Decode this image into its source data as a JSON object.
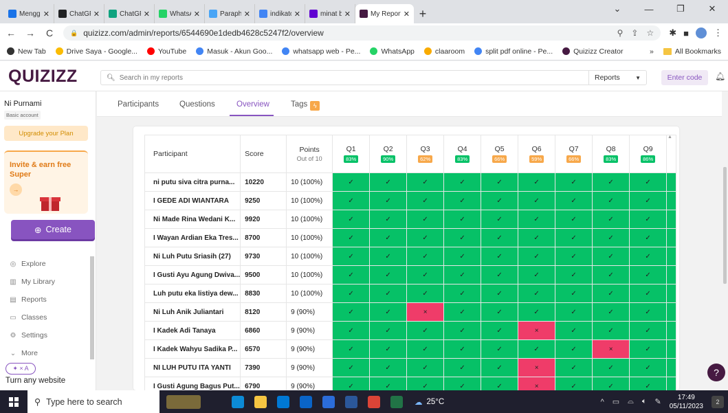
{
  "browser": {
    "tabs": [
      {
        "label": "Mengguna",
        "color": "#1a73e8"
      },
      {
        "label": "ChatGPT",
        "color": "#202123"
      },
      {
        "label": "ChatGPT",
        "color": "#10a37f"
      },
      {
        "label": "WhatsApp",
        "color": "#25d366"
      },
      {
        "label": "Paraphras",
        "color": "#49a5f6"
      },
      {
        "label": "indikator t",
        "color": "#4285f4"
      },
      {
        "label": "minat berp",
        "color": "#6001d2"
      },
      {
        "label": "My Report",
        "color": "#461a42"
      }
    ],
    "new_tab": "+",
    "url": "quizizz.com/admin/reports/6544690e1dedb4628c5247f2/overview",
    "bookmarks": [
      {
        "label": "New Tab",
        "color": "#333333"
      },
      {
        "label": "Drive Saya - Google...",
        "color": "#fbbc04"
      },
      {
        "label": "YouTube",
        "color": "#ff0000"
      },
      {
        "label": "Masuk - Akun Goo...",
        "color": "#4285f4"
      },
      {
        "label": "whatsapp web - Pe...",
        "color": "#4285f4"
      },
      {
        "label": "WhatsApp",
        "color": "#25d366"
      },
      {
        "label": "claaroom",
        "color": "#f9ab00"
      },
      {
        "label": "split pdf online - Pe...",
        "color": "#4285f4"
      },
      {
        "label": "Quizizz Creator",
        "color": "#461a42"
      }
    ],
    "more_bookmarks": "»",
    "all_bookmarks": "All Bookmarks"
  },
  "header": {
    "logo": "QUIZIZZ",
    "search_placeholder": "Search in my reports",
    "reports_select": "Reports",
    "enter_code": "Enter code"
  },
  "sidebar": {
    "user_name": "Ni Purnami",
    "account_type": "Basic account",
    "upgrade": "Upgrade your Plan",
    "invite": "Invite & earn free Super",
    "create": "Create",
    "nav": [
      "Explore",
      "My Library",
      "Reports",
      "Classes",
      "Settings",
      "More"
    ],
    "promo_pill": "✦ × A",
    "promo_text": "Turn any website"
  },
  "report_tabs": {
    "participants": "Participants",
    "questions": "Questions",
    "overview": "Overview",
    "tags": "Tags"
  },
  "table": {
    "headers": {
      "participant": "Participant",
      "score": "Score",
      "points": "Points",
      "points_sub": "Out of 10"
    },
    "questions": [
      {
        "label": "Q1",
        "pct": "83%",
        "color": "#06c167"
      },
      {
        "label": "Q2",
        "pct": "90%",
        "color": "#06c167"
      },
      {
        "label": "Q3",
        "pct": "62%",
        "color": "#f7a84a"
      },
      {
        "label": "Q4",
        "pct": "83%",
        "color": "#06c167"
      },
      {
        "label": "Q5",
        "pct": "66%",
        "color": "#f7a84a"
      },
      {
        "label": "Q6",
        "pct": "59%",
        "color": "#f7a84a"
      },
      {
        "label": "Q7",
        "pct": "66%",
        "color": "#f7a84a"
      },
      {
        "label": "Q8",
        "pct": "83%",
        "color": "#06c167"
      },
      {
        "label": "Q9",
        "pct": "86%",
        "color": "#06c167"
      }
    ],
    "rows": [
      {
        "name": "ni putu siva citra purna...",
        "score": "10220",
        "points": "10 (100%)",
        "answers": [
          1,
          1,
          1,
          1,
          1,
          1,
          1,
          1,
          1
        ]
      },
      {
        "name": "I GEDE ADI WIANTARA",
        "score": "9250",
        "points": "10 (100%)",
        "answers": [
          1,
          1,
          1,
          1,
          1,
          1,
          1,
          1,
          1
        ]
      },
      {
        "name": "Ni Made Rina Wedani K...",
        "score": "9920",
        "points": "10 (100%)",
        "answers": [
          1,
          1,
          1,
          1,
          1,
          1,
          1,
          1,
          1
        ]
      },
      {
        "name": "I Wayan Ardian Eka Tres...",
        "score": "8700",
        "points": "10 (100%)",
        "answers": [
          1,
          1,
          1,
          1,
          1,
          1,
          1,
          1,
          1
        ]
      },
      {
        "name": "Ni Luh Putu Sriasih (27)",
        "score": "9730",
        "points": "10 (100%)",
        "answers": [
          1,
          1,
          1,
          1,
          1,
          1,
          1,
          1,
          1
        ]
      },
      {
        "name": "I Gusti Ayu Agung Dwiva...",
        "score": "9500",
        "points": "10 (100%)",
        "answers": [
          1,
          1,
          1,
          1,
          1,
          1,
          1,
          1,
          1
        ]
      },
      {
        "name": "Luh putu eka listiya dew...",
        "score": "8830",
        "points": "10 (100%)",
        "answers": [
          1,
          1,
          1,
          1,
          1,
          1,
          1,
          1,
          1
        ]
      },
      {
        "name": "Ni Luh Anik Juliantari",
        "score": "8120",
        "points": "9 (90%)",
        "answers": [
          1,
          1,
          0,
          1,
          1,
          1,
          1,
          1,
          1
        ]
      },
      {
        "name": "I Kadek Adi Tanaya",
        "score": "6860",
        "points": "9 (90%)",
        "answers": [
          1,
          1,
          1,
          1,
          1,
          0,
          1,
          1,
          1
        ]
      },
      {
        "name": "I Kadek Wahyu Sadika P...",
        "score": "6570",
        "points": "9 (90%)",
        "answers": [
          1,
          1,
          1,
          1,
          1,
          1,
          1,
          0,
          1
        ]
      },
      {
        "name": "NI LUH PUTU ITA YANTI",
        "score": "7390",
        "points": "9 (90%)",
        "answers": [
          1,
          1,
          1,
          1,
          1,
          0,
          1,
          1,
          1
        ]
      },
      {
        "name": "I Gusti Agung Bagus Put...",
        "score": "6790",
        "points": "9 (90%)",
        "answers": [
          1,
          1,
          1,
          1,
          1,
          0,
          1,
          1,
          1
        ]
      }
    ],
    "correct_mark": "✓",
    "wrong_mark": "×"
  },
  "taskbar": {
    "search_placeholder": "Type here to search",
    "weather": "25°C",
    "time": "17:49",
    "date": "05/11/2023",
    "notifications": "2",
    "apps": [
      {
        "name": "landscape-thumb",
        "color": "#7a6a3a"
      },
      {
        "name": "task-view",
        "color": "#1f1f2e"
      },
      {
        "name": "edge",
        "color": "#0c8bd6"
      },
      {
        "name": "file-explorer",
        "color": "#f5c542"
      },
      {
        "name": "microsoft-store",
        "color": "#0078d4"
      },
      {
        "name": "mail",
        "color": "#0a64c8"
      },
      {
        "name": "media",
        "color": "#2b6cd9"
      },
      {
        "name": "word",
        "color": "#2b579a"
      },
      {
        "name": "chrome",
        "color": "#db4437"
      },
      {
        "name": "excel",
        "color": "#217346"
      }
    ]
  }
}
